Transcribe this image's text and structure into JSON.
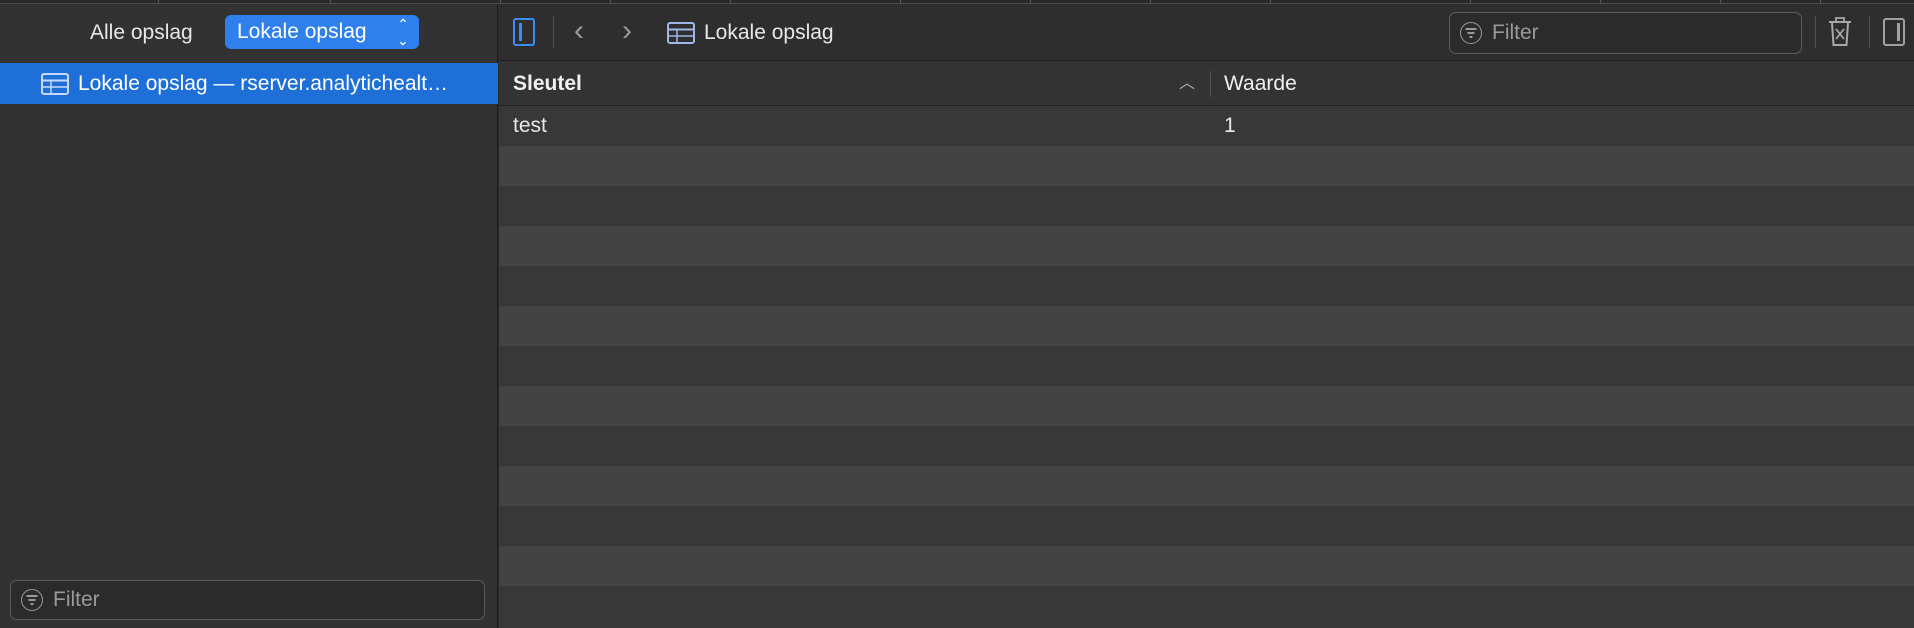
{
  "sidebar": {
    "scope_all": "Alle opslag",
    "scope_local": "Lokale opslag",
    "item_label": "Lokale opslag — rserver.analytichealt…",
    "filter_placeholder": "Filter"
  },
  "toolbar": {
    "title": "Lokale opslag",
    "filter_placeholder": "Filter"
  },
  "table": {
    "columns": [
      "Sleutel",
      "Waarde"
    ],
    "rows": [
      {
        "key": "test",
        "value": "1"
      }
    ]
  },
  "icons": [
    "sidebar-toggle-icon",
    "back-icon",
    "forward-icon",
    "table-icon",
    "filter-icon",
    "trash-icon",
    "inspector-toggle-icon",
    "sort-ascending-icon",
    "chevron-updown-icon"
  ],
  "colors": {
    "accent": "#2f80ed",
    "selection": "#1f6fd9",
    "background": "#383838",
    "row_alt": "#434343"
  }
}
